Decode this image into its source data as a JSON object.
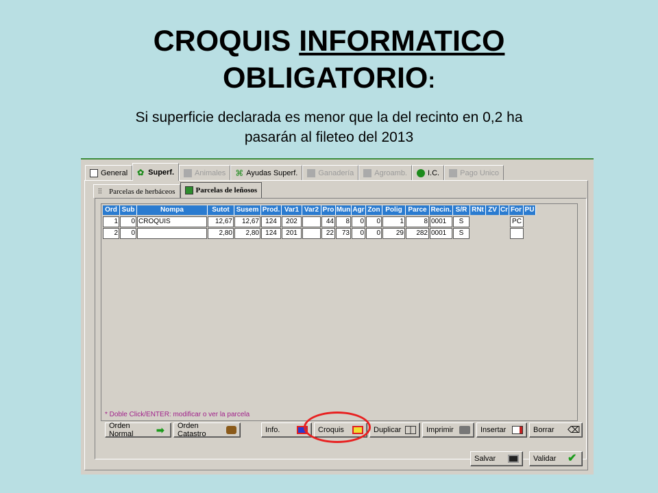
{
  "slide": {
    "title_part1": "CROQUIS ",
    "title_part2": "INFORMATICO",
    "title_line2": "OBLIGATORIO",
    "title_colon": ":",
    "subtitle_line1": "Si superficie declarada es menor que la del recinto en 0,2 ha",
    "subtitle_line2": "pasarán al fileteo del 2013"
  },
  "tabs": [
    {
      "label": "General",
      "enabled": true
    },
    {
      "label": "Superf.",
      "enabled": true,
      "active": true
    },
    {
      "label": "Animales",
      "enabled": false
    },
    {
      "label": "Ayudas Superf.",
      "enabled": true
    },
    {
      "label": "Ganadería",
      "enabled": false
    },
    {
      "label": "Agroamb.",
      "enabled": false
    },
    {
      "label": "I.C.",
      "enabled": true
    },
    {
      "label": "Pago Unico",
      "enabled": false
    }
  ],
  "subtabs": [
    {
      "label": "Parcelas de herbáceos"
    },
    {
      "label": "Parcelas de leñosos",
      "active": true
    }
  ],
  "table": {
    "columns": [
      "Ord",
      "Sub",
      "Nompa",
      "Sutot",
      "Susem",
      "Prod.",
      "Var1",
      "Var2",
      "Pro",
      "Mun",
      "Agr",
      "Zon",
      "Polig",
      "Parce",
      "Recin.",
      "S/R",
      "RNt",
      "ZV",
      "Cr",
      "For",
      "PU"
    ],
    "rows": [
      [
        "1",
        "0",
        "CROQUIS",
        "12,67",
        "12,67",
        "124",
        "202",
        "",
        "44",
        "8",
        "0",
        "0",
        "1",
        "8",
        "0001",
        "S",
        "",
        "",
        "",
        "PC",
        ""
      ],
      [
        "2",
        "0",
        "",
        "2,80",
        "2,80",
        "124",
        "201",
        "",
        "22",
        "73",
        "0",
        "0",
        "29",
        "282",
        "0001",
        "S",
        "",
        "",
        "",
        "",
        ""
      ]
    ]
  },
  "note": "* Doble Click/ENTER: modificar o ver la parcela",
  "buttons": {
    "orden_normal": "Orden Normal",
    "orden_catastro": "Orden Catastro",
    "info": "Info.",
    "croquis": "Croquis",
    "duplicar": "Duplicar",
    "imprimir": "Imprimir",
    "insertar": "Insertar",
    "borrar": "Borrar",
    "salvar": "Salvar",
    "validar": "Validar"
  },
  "colors": {
    "background": "#b9dfe3",
    "header_blue": "#2a7bd0",
    "highlight_circle": "#e82020",
    "note_text": "#a0208a"
  }
}
